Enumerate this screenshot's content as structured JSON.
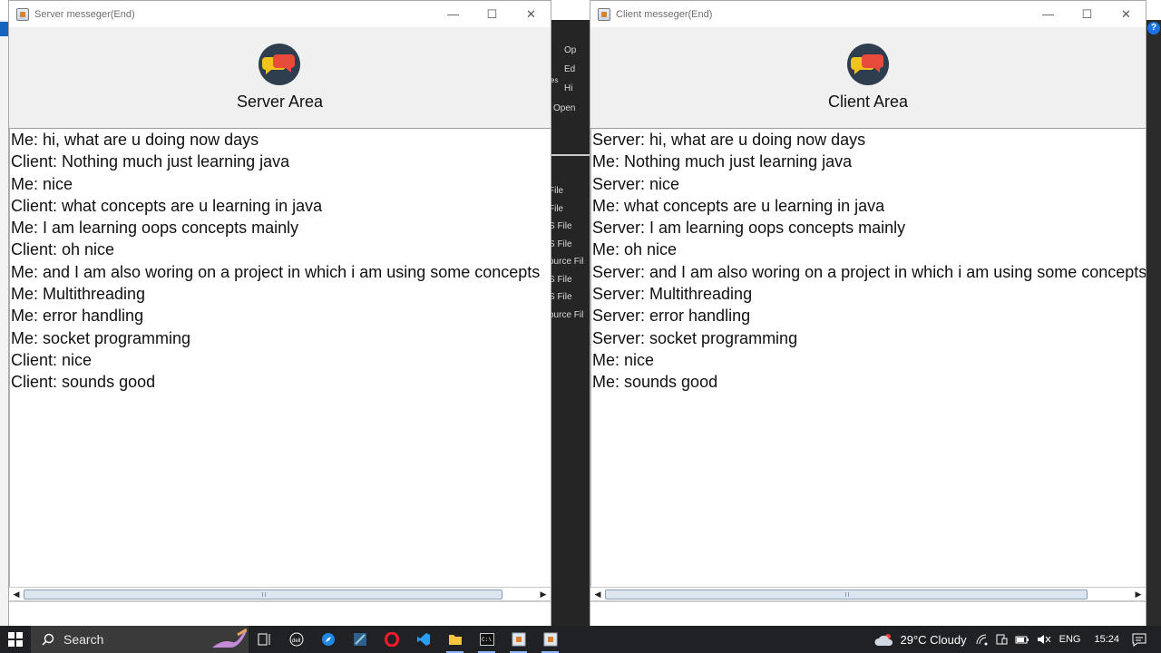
{
  "server_window": {
    "title": "Server messeger(End)",
    "header_title": "Server Area",
    "messages": [
      "Me: hi, what are u doing now days",
      "Client: Nothing much just learning java",
      "Me: nice",
      "Client: what concepts are u learning in java",
      "Me: I am learning oops concepts mainly",
      "Client: oh nice",
      "Me: and I am also woring on a project in which i am using some concepts",
      "Me: Multithreading",
      "Me: error handling",
      "Me: socket programming",
      "Client: nice",
      "Client: sounds good"
    ]
  },
  "client_window": {
    "title": "Client messeger(End)",
    "header_title": "Client Area",
    "messages": [
      "Server: hi, what are u doing now days",
      "Me: Nothing much just learning java",
      "Server: nice",
      "Me: what concepts are u learning in java",
      "Server: I am learning oops concepts mainly",
      "Me: oh nice",
      "Server: and I am also woring on a project in which i am using some concepts",
      "Server: Multithreading",
      "Server: error handling",
      "Server: socket programming",
      "Me: nice",
      "Me: sounds good"
    ]
  },
  "window_controls": {
    "minimize": "—",
    "maximize": "☐",
    "close": "✕"
  },
  "background_ide": {
    "items": [
      "Op",
      "Ed",
      "Hi",
      "Open",
      "File",
      "File",
      "S File",
      "S File",
      "ource Fil",
      "S File",
      "S File",
      "ource Fil"
    ],
    "side_letters": "es"
  },
  "taskbar": {
    "search_placeholder": "Search",
    "weather": "29°C  Cloudy",
    "language": "ENG",
    "time": "15:24"
  },
  "colors": {
    "logo_bg": "#2f3e4e",
    "bubble_red": "#e84b3c",
    "bubble_yellow": "#f4c21a",
    "taskbar": "#202124"
  }
}
